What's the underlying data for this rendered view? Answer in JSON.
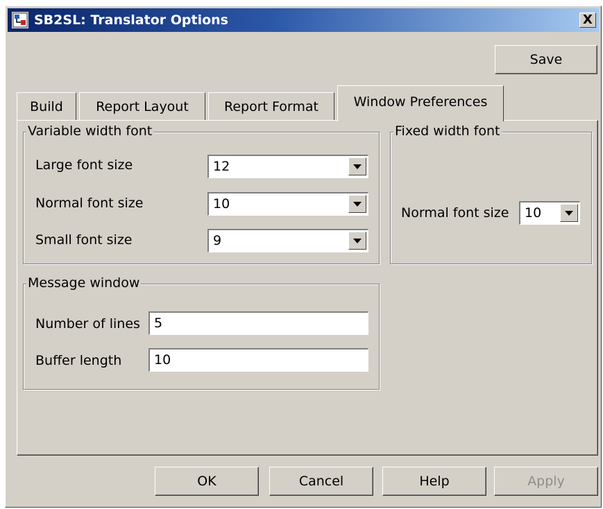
{
  "window": {
    "title": "SB2SL: Translator Options",
    "close_label": "X"
  },
  "toolbar": {
    "save_label": "Save"
  },
  "tabs": [
    {
      "label": "Build",
      "active": false
    },
    {
      "label": "Report Layout",
      "active": false
    },
    {
      "label": "Report Format",
      "active": false
    },
    {
      "label": "Window Preferences",
      "active": true
    }
  ],
  "variable_width_font": {
    "title": "Variable width font",
    "rows": [
      {
        "label": "Large font size",
        "value": "12"
      },
      {
        "label": "Normal font size",
        "value": "10"
      },
      {
        "label": "Small font size",
        "value": "9"
      }
    ]
  },
  "fixed_width_font": {
    "title": "Fixed width font",
    "normal_label": "Normal font size",
    "normal_value": "10"
  },
  "message_window": {
    "title": "Message window",
    "number_of_lines_label": "Number of lines",
    "number_of_lines_value": "5",
    "buffer_length_label": "Buffer length",
    "buffer_length_value": "10"
  },
  "footer": {
    "ok_label": "OK",
    "cancel_label": "Cancel",
    "help_label": "Help",
    "apply_label": "Apply",
    "apply_disabled": true
  },
  "colors": {
    "dialog_bg": "#d4d0c8",
    "titlebar_start": "#0a246a",
    "titlebar_end": "#a6caf0",
    "disabled_text": "#8d8d8d"
  }
}
